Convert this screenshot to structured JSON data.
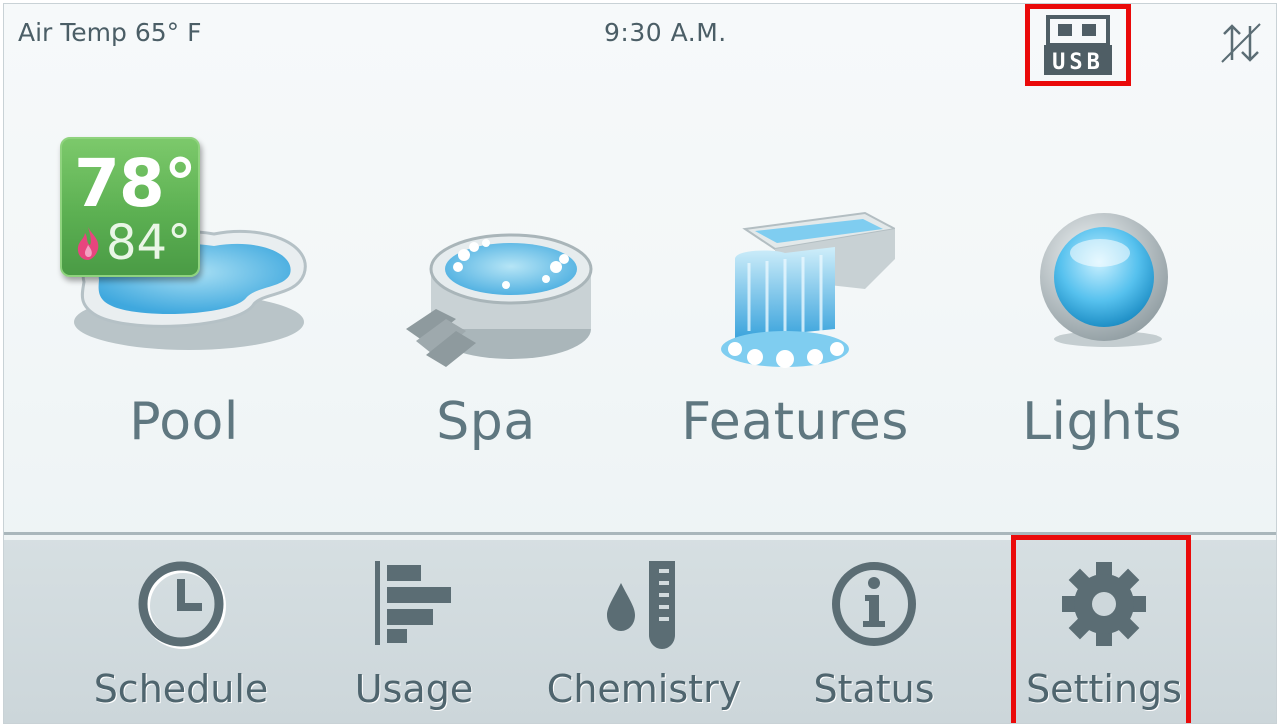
{
  "header": {
    "air_temp": "Air Temp 65° F",
    "time": "9:30 A.M.",
    "usb_label": "USB",
    "usb_icon": "usb-icon",
    "swap_icon": "swap-arrows-icon"
  },
  "tiles": [
    {
      "label": "Pool",
      "icon": "pool-icon"
    },
    {
      "label": "Spa",
      "icon": "spa-icon"
    },
    {
      "label": "Features",
      "icon": "waterfall-icon"
    },
    {
      "label": "Lights",
      "icon": "light-icon"
    }
  ],
  "pool_badge": {
    "water_temp": "78°",
    "set_temp": "84°",
    "heater_icon": "flame-icon",
    "badge_color": "#5cb052",
    "flame_color": "#e8457e"
  },
  "nav": [
    {
      "label": "Schedule",
      "icon": "clock-icon"
    },
    {
      "label": "Usage",
      "icon": "bar-chart-icon"
    },
    {
      "label": "Chemistry",
      "icon": "drop-thermometer-icon"
    },
    {
      "label": "Status",
      "icon": "info-icon"
    },
    {
      "label": "Settings",
      "icon": "gear-icon"
    }
  ],
  "colors": {
    "highlight": "#ea0a0a",
    "text": "#5f7780",
    "icon": "#5b6d74"
  }
}
